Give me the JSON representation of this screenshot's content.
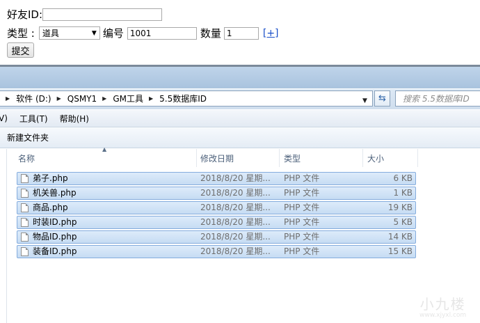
{
  "form": {
    "friend_id_label": "好友ID:",
    "friend_id_value": "",
    "type_label": "类型 :",
    "type_selected": "道具",
    "number_label": "编号",
    "number_value": "1001",
    "quantity_label": "数量",
    "quantity_value": "1",
    "add_link": "[+]",
    "submit_label": "提交"
  },
  "explorer": {
    "breadcrumb": [
      "软件 (D:)",
      "QSMY1",
      "GM工具",
      "5.5数据库ID"
    ],
    "search_placeholder": "搜索 5.5数据库ID",
    "menu": [
      "V)",
      "工具(T)",
      "帮助(H)"
    ],
    "toolbar_new_folder": "新建文件夹",
    "columns": [
      "名称",
      "修改日期",
      "类型",
      "大小"
    ],
    "files": [
      {
        "name": "弟子.php",
        "date": "2018/8/20 星期...",
        "type": "PHP 文件",
        "size": "6 KB"
      },
      {
        "name": "机关兽.php",
        "date": "2018/8/20 星期...",
        "type": "PHP 文件",
        "size": "1 KB"
      },
      {
        "name": "商品.php",
        "date": "2018/8/20 星期...",
        "type": "PHP 文件",
        "size": "19 KB"
      },
      {
        "name": "时装ID.php",
        "date": "2018/8/20 星期...",
        "type": "PHP 文件",
        "size": "5 KB"
      },
      {
        "name": "物品ID.php",
        "date": "2018/8/20 星期...",
        "type": "PHP 文件",
        "size": "14 KB"
      },
      {
        "name": "装备ID.php",
        "date": "2018/8/20 星期...",
        "type": "PHP 文件",
        "size": "15 KB"
      }
    ]
  },
  "watermark": {
    "big": "小九楼",
    "small": "www.xjyxl.com"
  },
  "icons": {
    "breadcrumb_separator": "triangle-right-icon",
    "refresh": "refresh-icon",
    "file": "file-icon",
    "sort": "sort-up-icon",
    "dropdown": "chevron-down-icon"
  }
}
